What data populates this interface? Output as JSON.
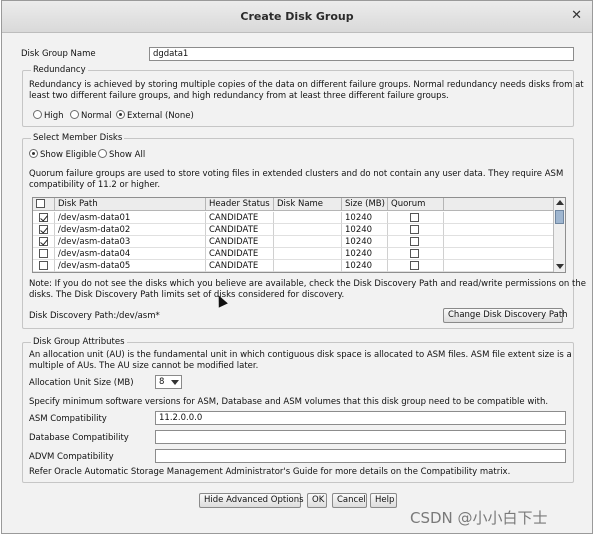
{
  "window": {
    "title": "Create Disk Group"
  },
  "disk_group_name": {
    "label": "Disk Group Name",
    "value": "dgdata1"
  },
  "redundancy": {
    "legend": "Redundancy",
    "description_line1": "Redundancy is achieved by storing multiple copies of the data on different failure groups. Normal redundancy needs disks from at",
    "description_line2": "least two different failure groups, and high redundancy from at least three different failure groups.",
    "options": [
      "High",
      "Normal",
      "External (None)"
    ],
    "selected": "External (None)"
  },
  "member_disks": {
    "legend": "Select Member Disks",
    "filter_options": [
      "Show Eligible",
      "Show All"
    ],
    "selected_filter": "Show Eligible",
    "quorum_note_line1": "Quorum failure groups are used to store voting files in extended clusters and do not contain any user data. They require ASM",
    "quorum_note_line2": "compatibility of 11.2 or higher.",
    "columns": [
      "",
      "Disk Path",
      "Header Status",
      "Disk Name",
      "Size (MB)",
      "Quorum"
    ],
    "rows": [
      {
        "checked": true,
        "path": "/dev/asm-data01",
        "status": "CANDIDATE",
        "name": "",
        "size": "10240",
        "quorum": false
      },
      {
        "checked": true,
        "path": "/dev/asm-data02",
        "status": "CANDIDATE",
        "name": "",
        "size": "10240",
        "quorum": false
      },
      {
        "checked": true,
        "path": "/dev/asm-data03",
        "status": "CANDIDATE",
        "name": "",
        "size": "10240",
        "quorum": false
      },
      {
        "checked": false,
        "path": "/dev/asm-data04",
        "status": "CANDIDATE",
        "name": "",
        "size": "10240",
        "quorum": false
      },
      {
        "checked": false,
        "path": "/dev/asm-data05",
        "status": "CANDIDATE",
        "name": "",
        "size": "10240",
        "quorum": false
      }
    ],
    "discovery_note_line1": "Note: If you do not see the disks which you believe are available, check the Disk Discovery Path and read/write permissions on the",
    "discovery_note_line2": "disks. The Disk Discovery Path limits set of disks considered for discovery.",
    "discovery_path": "Disk Discovery Path:/dev/asm*",
    "change_path_button": "Change Disk Discovery Path"
  },
  "attributes": {
    "legend": "Disk Group Attributes",
    "au_note_line1": "An allocation unit (AU) is the fundamental unit in which contiguous disk space is allocated to ASM files. ASM file extent size is a",
    "au_note_line2": "multiple of AUs. The AU size cannot be modified later.",
    "au_size_label": "Allocation Unit Size (MB)",
    "au_size_value": "8",
    "compat_note": "Specify minimum software versions for ASM, Database and ASM volumes that this disk group need to be compatible with.",
    "asm_compat_label": "ASM Compatibility",
    "asm_compat_value": "11.2.0.0.0",
    "db_compat_label": "Database Compatibility",
    "db_compat_value": "",
    "advm_compat_label": "ADVM Compatibility",
    "advm_compat_value": "",
    "refer_note": "Refer Oracle Automatic Storage Management Administrator's Guide for more details on the Compatibility matrix."
  },
  "buttons": {
    "hide_advanced": "Hide Advanced Options",
    "ok": "OK",
    "cancel": "Cancel",
    "help": "Help"
  },
  "watermark": "CSDN @小小白下士"
}
